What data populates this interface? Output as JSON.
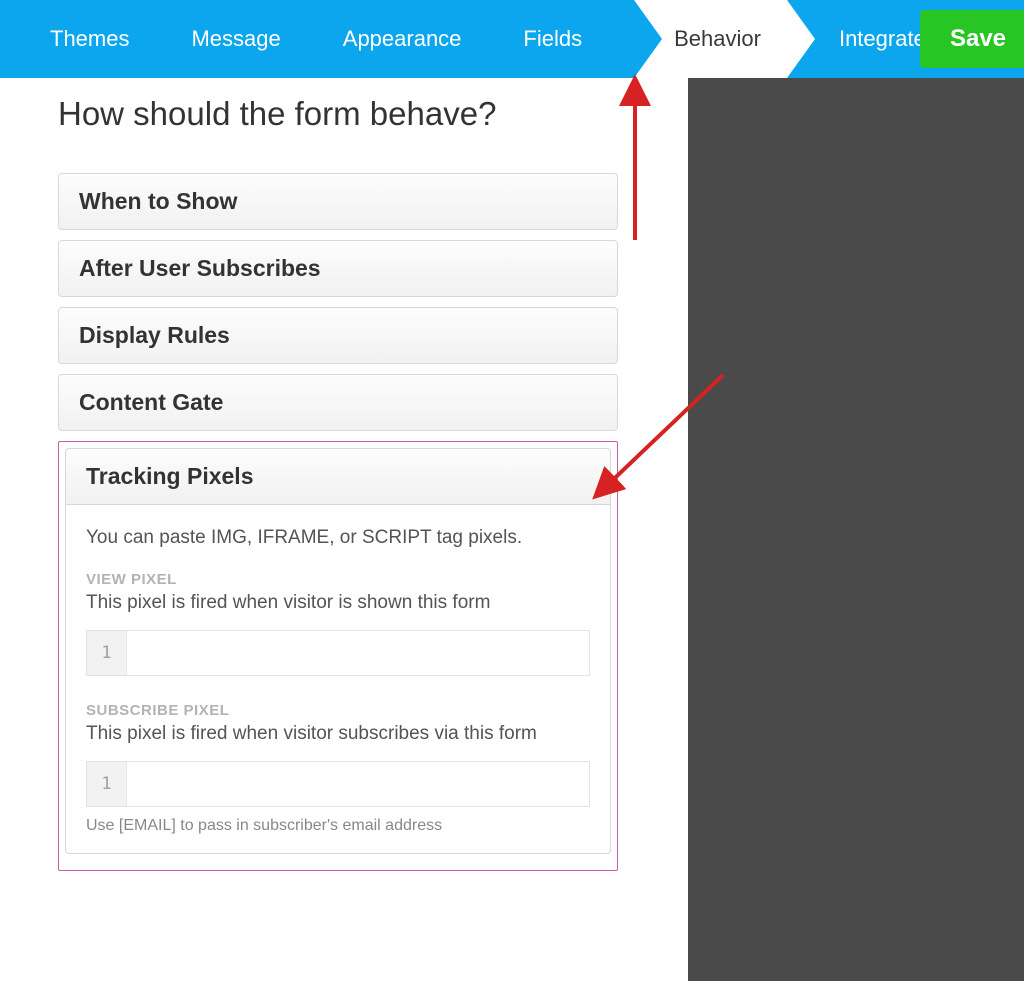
{
  "nav": {
    "themes": "Themes",
    "message": "Message",
    "appearance": "Appearance",
    "fields": "Fields",
    "behavior": "Behavior",
    "integrate": "Integrate",
    "save": "Save"
  },
  "page_title": "How should the form behave?",
  "sections": {
    "when_to_show": "When to Show",
    "after_subscribe": "After User Subscribes",
    "display_rules": "Display Rules",
    "content_gate": "Content Gate",
    "tracking_pixels": "Tracking Pixels"
  },
  "tracking": {
    "intro": "You can paste IMG, IFRAME, or SCRIPT tag pixels.",
    "view_label": "VIEW PIXEL",
    "view_desc": "This pixel is fired when visitor is shown this form",
    "view_line": "1",
    "view_value": "",
    "sub_label": "SUBSCRIBE PIXEL",
    "sub_desc": "This pixel is fired when visitor subscribes via this form",
    "sub_line": "1",
    "sub_value": "",
    "help": "Use [EMAIL] to pass in subscriber's email address"
  }
}
